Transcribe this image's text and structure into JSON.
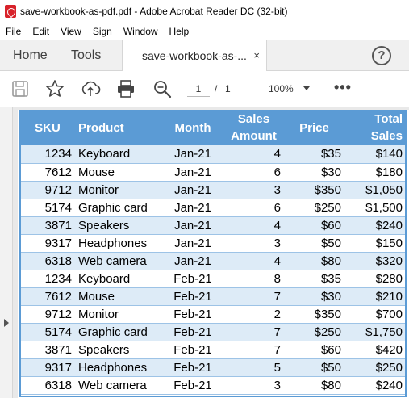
{
  "window": {
    "title": "save-workbook-as-pdf.pdf - Adobe Acrobat Reader DC (32-bit)"
  },
  "menu": [
    "File",
    "Edit",
    "View",
    "Sign",
    "Window",
    "Help"
  ],
  "tabs": {
    "home": "Home",
    "tools": "Tools",
    "document": "save-workbook-as-...",
    "close": "×",
    "help": "?"
  },
  "toolbar": {
    "icons": [
      "save-icon",
      "bookmark-star-icon",
      "upload-share-icon",
      "print-icon",
      "zoom-search-icon"
    ],
    "current_page": "1",
    "page_separator": "/",
    "total_pages": "1",
    "zoom": "100%",
    "more": "•••"
  },
  "table": {
    "headers": [
      "SKU",
      "Product",
      "Month",
      "Sales\nAmount",
      "Price",
      "Total\nSales"
    ],
    "rows": [
      [
        "1234",
        "Keyboard",
        "Jan-21",
        "4",
        "$35",
        "$140"
      ],
      [
        "7612",
        "Mouse",
        "Jan-21",
        "6",
        "$30",
        "$180"
      ],
      [
        "9712",
        "Monitor",
        "Jan-21",
        "3",
        "$350",
        "$1,050"
      ],
      [
        "5174",
        "Graphic card",
        "Jan-21",
        "6",
        "$250",
        "$1,500"
      ],
      [
        "3871",
        "Speakers",
        "Jan-21",
        "4",
        "$60",
        "$240"
      ],
      [
        "9317",
        "Headphones",
        "Jan-21",
        "3",
        "$50",
        "$150"
      ],
      [
        "6318",
        "Web camera",
        "Jan-21",
        "4",
        "$80",
        "$320"
      ],
      [
        "1234",
        "Keyboard",
        "Feb-21",
        "8",
        "$35",
        "$280"
      ],
      [
        "7612",
        "Mouse",
        "Feb-21",
        "7",
        "$30",
        "$210"
      ],
      [
        "9712",
        "Monitor",
        "Feb-21",
        "2",
        "$350",
        "$700"
      ],
      [
        "5174",
        "Graphic card",
        "Feb-21",
        "7",
        "$250",
        "$1,750"
      ],
      [
        "3871",
        "Speakers",
        "Feb-21",
        "7",
        "$60",
        "$420"
      ],
      [
        "9317",
        "Headphones",
        "Feb-21",
        "5",
        "$50",
        "$250"
      ],
      [
        "6318",
        "Web camera",
        "Feb-21",
        "3",
        "$80",
        "$240"
      ]
    ]
  },
  "colors": {
    "header_bg": "#5b9bd5",
    "band_bg": "#ddebf7",
    "pdf_icon": "#d8222a"
  }
}
